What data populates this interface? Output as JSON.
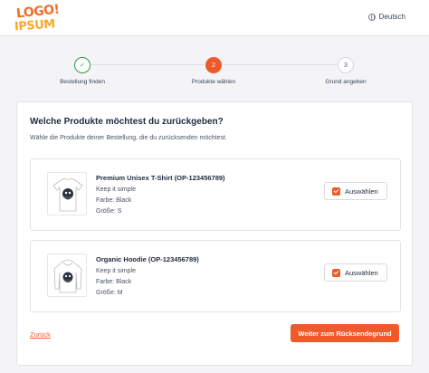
{
  "header": {
    "logo_line1": "LOGO!",
    "logo_line2": "IPSUM",
    "language": "Deutsch"
  },
  "steps": [
    {
      "number": "✓",
      "label": "Bestellung finden",
      "state": "done"
    },
    {
      "number": "2",
      "label": "Produkte wählen",
      "state": "active"
    },
    {
      "number": "3",
      "label": "Grund angeben",
      "state": "pending"
    }
  ],
  "main": {
    "title": "Welche Produkte möchtest du zurückgeben?",
    "subtitle": "Wähle die Produkte deiner Bestellung, die du zurücksenden möchtest.",
    "products": [
      {
        "name": "Premium Unisex T-Shirt (OP-123456789)",
        "line1": "Keep it simple",
        "line2": "Farbe: Black",
        "line3": "Größe: S",
        "select_label": "Auswählen",
        "selected": true,
        "icon": "tshirt-icon"
      },
      {
        "name": "Organic Hoodie (OP-123456789)",
        "line1": "Keep it simple",
        "line2": "Farbe: Black",
        "line3": "Größe: M",
        "select_label": "Auswählen",
        "selected": true,
        "icon": "hoodie-icon"
      }
    ],
    "back_label": "Zurück",
    "next_label": "Weiter zum Rücksendegrund"
  },
  "colors": {
    "accent": "#ef5a2a",
    "success": "#2e9a4b",
    "background": "#f4f4f6"
  }
}
